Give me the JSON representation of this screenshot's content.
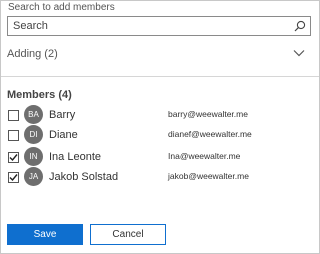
{
  "search": {
    "label": "Search to add members",
    "placeholder": "Search",
    "value": ""
  },
  "adding": {
    "label": "Adding (2)"
  },
  "members": {
    "title": "Members (4)",
    "items": [
      {
        "initials": "BA",
        "name": "Barry",
        "email": "barry@weewalter.me",
        "checked": false
      },
      {
        "initials": "DI",
        "name": "Diane",
        "email": "dianef@weewalter.me",
        "checked": false
      },
      {
        "initials": "IN",
        "name": "Ina Leonte",
        "email": "Ina@weewalter.me",
        "checked": true
      },
      {
        "initials": "JA",
        "name": "Jakob Solstad",
        "email": "jakob@weewalter.me",
        "checked": true
      }
    ]
  },
  "actions": {
    "save_label": "Save",
    "cancel_label": "Cancel"
  },
  "colors": {
    "accent": "#0f6fcf",
    "avatar": "#6e6e6e"
  }
}
